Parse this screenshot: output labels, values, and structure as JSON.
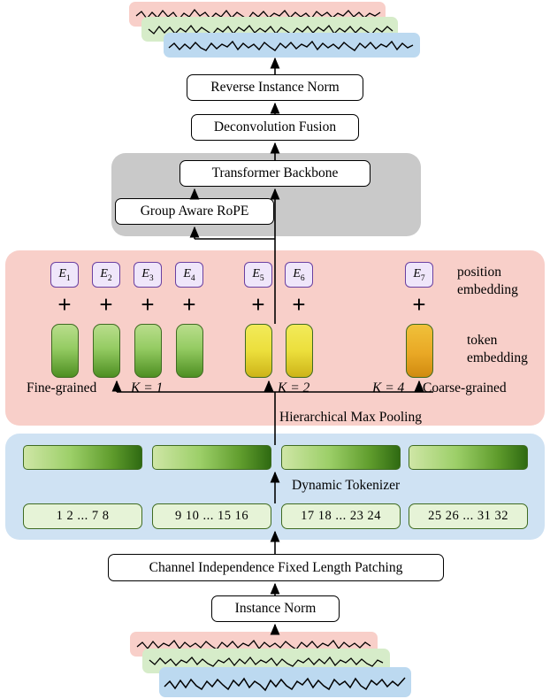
{
  "diagram": {
    "title": "Model architecture pipeline",
    "boxes": {
      "reverse_instance_norm": "Reverse Instance  Norm",
      "deconvolution_fusion": "Deconvolution Fusion",
      "transformer_backbone": "Transformer Backbone",
      "group_aware_rope": "Group Aware RoPE",
      "channel_independence": "Channel Independence Fixed Length Patching",
      "instance_norm": "Instance Norm"
    },
    "labels": {
      "position_embedding_line1": "position",
      "position_embedding_line2": "embedding",
      "token_embedding_line1": "token",
      "token_embedding_line2": "embedding",
      "fine_grained": "Fine-grained",
      "coarse_grained": "Coarse-grained",
      "hierarchical_max_pooling": "Hierarchical Max Pooling",
      "dynamic_tokenizer": "Dynamic Tokenizer",
      "k1": "K = 1",
      "k2": "K = 2",
      "k4": "K = 4"
    },
    "embeddings": [
      {
        "name": "E",
        "index": "1"
      },
      {
        "name": "E",
        "index": "2"
      },
      {
        "name": "E",
        "index": "3"
      },
      {
        "name": "E",
        "index": "4"
      },
      {
        "name": "E",
        "index": "5"
      },
      {
        "name": "E",
        "index": "6"
      },
      {
        "name": "E",
        "index": "7"
      }
    ],
    "plus_symbol": "+",
    "patch_numbers": [
      "1   2  ...  7   8",
      "9 10 ... 15 16",
      "17 18 ... 23 24",
      "25 26 ... 31 32"
    ],
    "colors": {
      "panel_pink": "#f8cfc9",
      "panel_blue": "#cfe2f3",
      "panel_gray": "#c9c9c9",
      "embedding_chip_border": "#6a3fa0",
      "embedding_chip_fill": "#efe6fa",
      "token_green": "#95cc63",
      "token_yellow": "#ecdf3c",
      "token_orange": "#e9a825",
      "signal_pink": "#f8cfc9",
      "signal_green": "#d6ecc9",
      "signal_blue": "#bcd9f0",
      "stroke": "#000000"
    }
  }
}
